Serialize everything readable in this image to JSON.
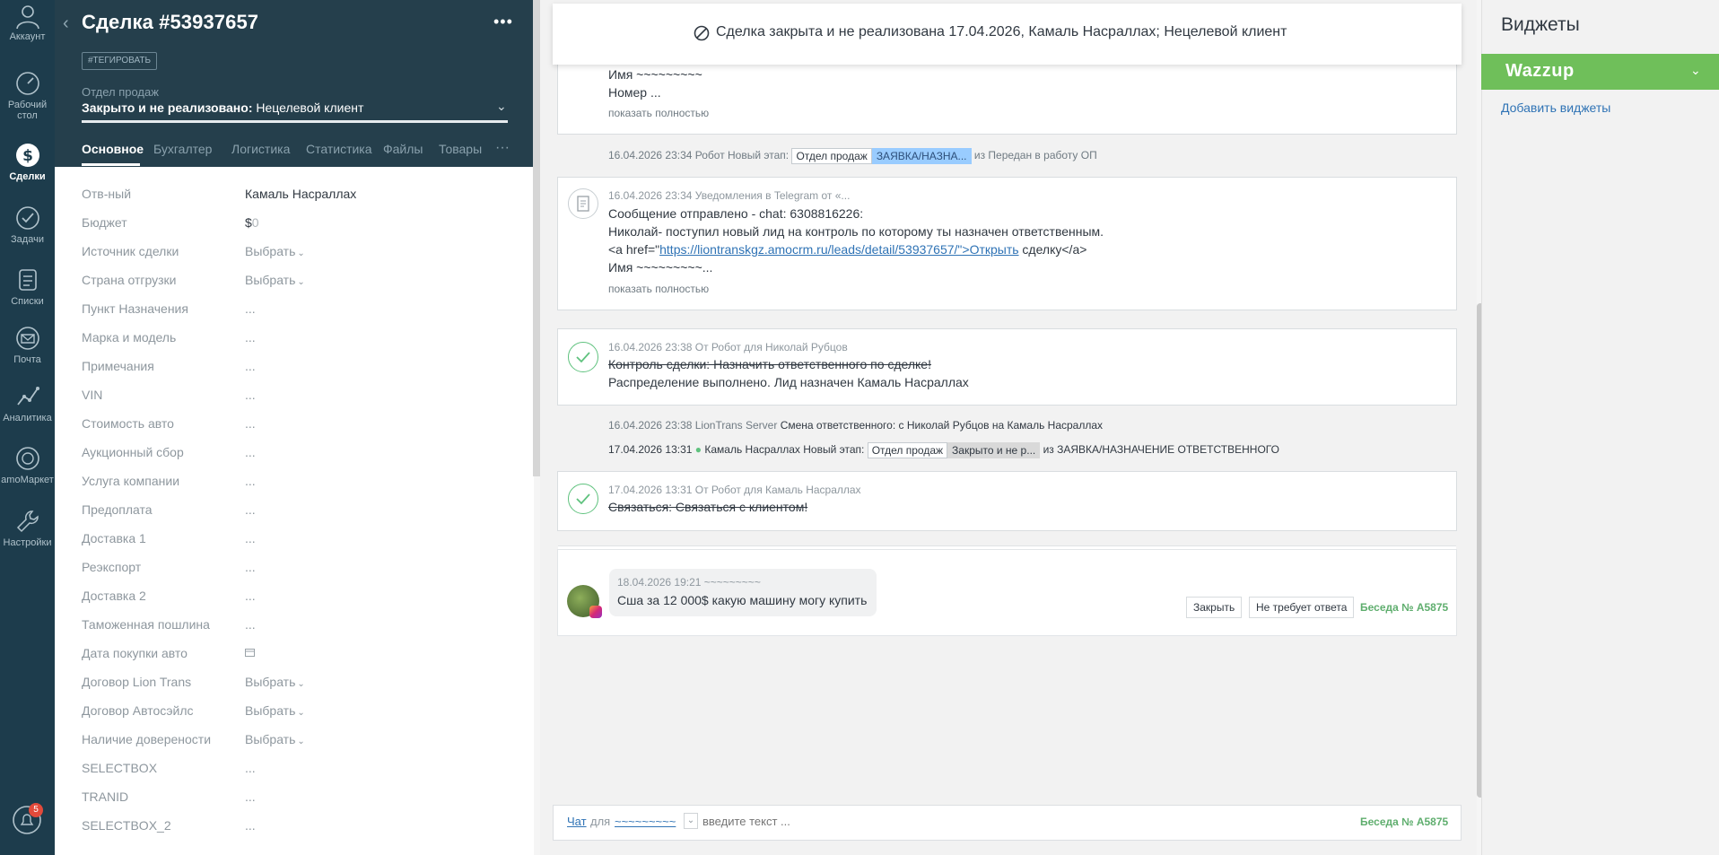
{
  "nav": {
    "items": [
      {
        "label": "Аккаунт"
      },
      {
        "label": "Рабочий стол"
      },
      {
        "label": "Сделки"
      },
      {
        "label": "Задачи"
      },
      {
        "label": "Списки"
      },
      {
        "label": "Почта"
      },
      {
        "label": "Аналитика"
      },
      {
        "label": "amoМаркет"
      },
      {
        "label": "Настройки"
      }
    ],
    "notification_count": "5"
  },
  "card": {
    "title": "Сделка #53937657",
    "tag_button": "#ТЕГИРОВАТЬ",
    "pipeline": "Отдел продаж",
    "status_strong": "Закрыто и не реализовано:",
    "status_reason": "Нецелевой клиент",
    "tabs": [
      "Основное",
      "Бухгалтер",
      "Логистика",
      "Статистика",
      "Файлы",
      "Товары"
    ]
  },
  "fields": [
    {
      "label": "Отв-ный",
      "value": "Камаль Насраллах"
    },
    {
      "label": "Бюджет",
      "value": "$",
      "value_muted": "0"
    },
    {
      "label": "Источник сделки",
      "value": "Выбрать"
    },
    {
      "label": "Страна отгрузки",
      "value": "Выбрать"
    },
    {
      "label": "Пункт Назначения",
      "value": "..."
    },
    {
      "label": "Марка и модель",
      "value": "..."
    },
    {
      "label": "Примечания",
      "value": "..."
    },
    {
      "label": "VIN",
      "value": "..."
    },
    {
      "label": "Стоимость авто",
      "value": "..."
    },
    {
      "label": "Аукционный сбор",
      "value": "..."
    },
    {
      "label": "Услуга компании",
      "value": "..."
    },
    {
      "label": "Предоплата",
      "value": "..."
    },
    {
      "label": "Доставка 1",
      "value": "..."
    },
    {
      "label": "Реэкспорт",
      "value": "..."
    },
    {
      "label": "Доставка 2",
      "value": "..."
    },
    {
      "label": "Таможенная пошлина",
      "value": "..."
    },
    {
      "label": "Дата покупки авто",
      "value": ""
    },
    {
      "label": "Договор Lion Trans",
      "value": "Выбрать"
    },
    {
      "label": "Договор Автосэйлс",
      "value": "Выбрать"
    },
    {
      "label": "Наличие довереноcти",
      "value": "Выбрать"
    },
    {
      "label": "SELECTBOX",
      "value": "..."
    },
    {
      "label": "TRANID",
      "value": "..."
    },
    {
      "label": "SELECTBOX_2",
      "value": "..."
    }
  ],
  "feed": {
    "banner": "Сделка закрыта и не реализована 17.04.2026, Камаль Насраллах; Нецелевой клиент",
    "note1": {
      "line1": "Имя ~~~~~~~~~",
      "line2": "Номер ...",
      "more": "показать полностью"
    },
    "sys1": {
      "time": "16.04.2026 23:34 Робот Новый этап:",
      "chip1": "Отдел продаж",
      "chip2": "ЗАЯВКА/НАЗНА...",
      "tail": "из Передан в работу ОП"
    },
    "telegram": {
      "time": "16.04.2026 23:34 Уведомления в Telegram от «...",
      "line1": "Сообщение отправлено - chat: 6308816226:",
      "line2": "Николай- поступил новый лид на контроль по которому ты назначен ответственным.",
      "line3_pre": "<a href=\"",
      "line3_link": "https://liontranskgz.amocrm.ru/leads/detail/53937657/\">Открыть",
      "line3_post": " сделку</a>",
      "line4": "Имя ~~~~~~~~~...",
      "more": "показать полностью"
    },
    "task1": {
      "time": "16.04.2026 23:38  От Робот для Николай Рубцов",
      "done": "Контроль сделки: Назначить ответственного по сделке!",
      "result": "Распределение выполнено. Лид назначен Камаль Насраллах"
    },
    "sys2": {
      "time": "16.04.2026 23:38 LionTrans Server",
      "text": "Смена ответственного: с Николай Рубцов на Камаль Насраллах"
    },
    "sys3": {
      "time": "17.04.2026 13:31",
      "who": "Камаль Насраллах",
      "stage": "Новый этап:",
      "chip1": "Отдел продаж",
      "chip2": "Закрыто и не р...",
      "tail": "из ЗАЯВКА/НАЗНАЧЕНИЕ ОТВЕТСТВЕННОГО"
    },
    "task2": {
      "time": "17.04.2026 13:31  От Робот для Камаль Насраллах",
      "done": "Связаться: Связаться с клиентом!"
    },
    "chat_msg": {
      "time": "18.04.2026 19:21 ~~~~~~~~~",
      "text": "Сша за 12 000$ какую машину могу купить",
      "close": "Закрыть",
      "no_reply": "Не требует ответа",
      "convo": "Беседа № A5875"
    },
    "chat_bar": {
      "chat": "Чат",
      "for": "для",
      "recipient": "~~~~~~~~~",
      "placeholder": "введите текст ...",
      "convo": "Беседа № A5875"
    }
  },
  "widgets": {
    "title": "Виджеты",
    "wazzup": "Wazzup",
    "add": "Добавить виджеты"
  },
  "colors": {
    "nav": "#1d3c4c",
    "header": "#253f4c",
    "wazzup": "#6fbf5a",
    "accent_link": "#2f73b5",
    "check": "#5fc27e"
  }
}
